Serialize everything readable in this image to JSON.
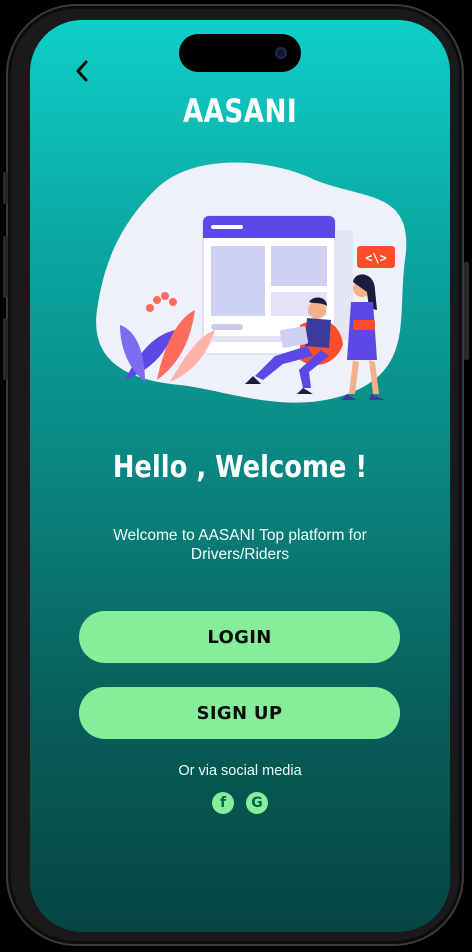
{
  "app": {
    "title": "AASANI"
  },
  "welcome": {
    "heading": "Hello , Welcome !",
    "subtitle": "Welcome to AASANI Top platform for Drivers/Riders"
  },
  "buttons": {
    "login_label": "LOGIN",
    "signup_label": "SIGN UP"
  },
  "social": {
    "text": "Or  via social media",
    "icons": [
      "facebook-icon",
      "google-icon"
    ],
    "facebook_glyph": "f",
    "google_glyph": "G"
  },
  "illustration": {
    "code_tag": "<\\>"
  },
  "colors": {
    "gradient_top": "#0fcfc8",
    "gradient_bottom": "#054642",
    "button_bg": "#86ee9a",
    "button_text": "#0b0b0b",
    "text_primary": "#ffffff"
  }
}
